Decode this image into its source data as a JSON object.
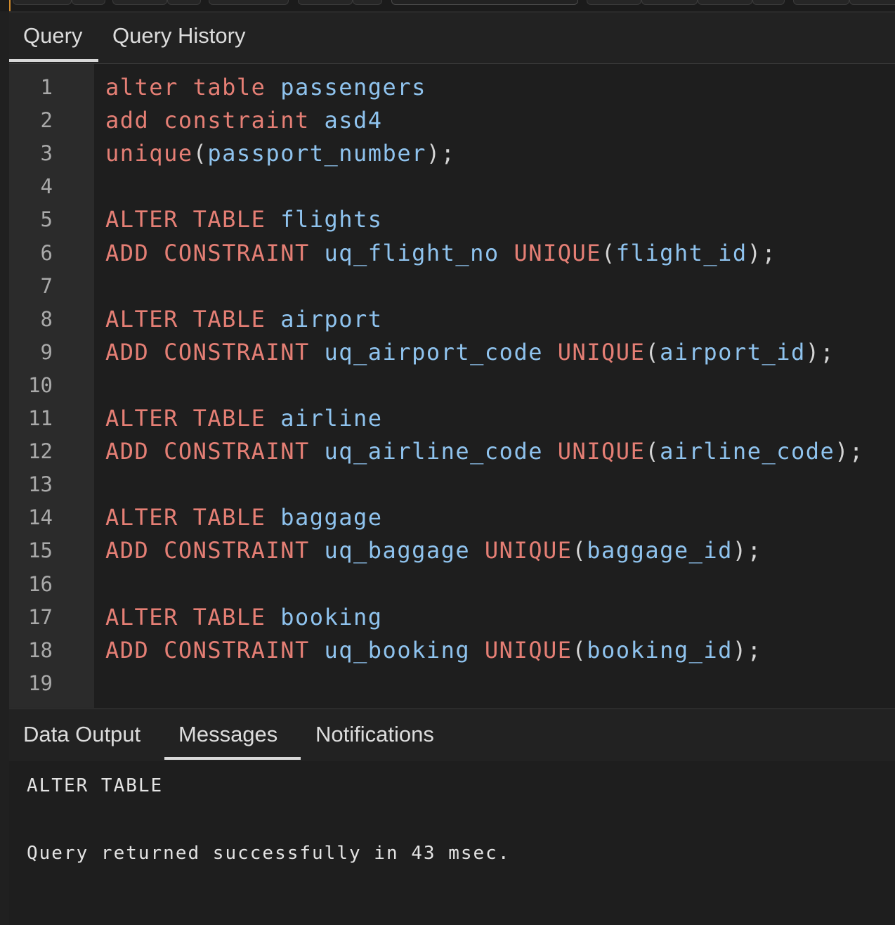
{
  "query_tabs": [
    {
      "label": "Query",
      "active": true
    },
    {
      "label": "Query History",
      "active": false
    }
  ],
  "editor": {
    "line_numbers": [
      "1",
      "2",
      "3",
      "4",
      "5",
      "6",
      "7",
      "8",
      "9",
      "10",
      "11",
      "12",
      "13",
      "14",
      "15",
      "16",
      "17",
      "18",
      "19"
    ],
    "lines": [
      [
        {
          "t": "alter",
          "c": "kw"
        },
        {
          "t": " ",
          "c": "pu"
        },
        {
          "t": "table",
          "c": "kw"
        },
        {
          "t": " ",
          "c": "pu"
        },
        {
          "t": "passengers",
          "c": "id"
        }
      ],
      [
        {
          "t": "add",
          "c": "kw"
        },
        {
          "t": " ",
          "c": "pu"
        },
        {
          "t": "constraint",
          "c": "kw"
        },
        {
          "t": " ",
          "c": "pu"
        },
        {
          "t": "asd4",
          "c": "id"
        }
      ],
      [
        {
          "t": "unique",
          "c": "kw"
        },
        {
          "t": "(",
          "c": "pu"
        },
        {
          "t": "passport_number",
          "c": "id"
        },
        {
          "t": ");",
          "c": "pu"
        }
      ],
      [],
      [
        {
          "t": "ALTER",
          "c": "kw"
        },
        {
          "t": " ",
          "c": "pu"
        },
        {
          "t": "TABLE",
          "c": "kw"
        },
        {
          "t": " ",
          "c": "pu"
        },
        {
          "t": "flights",
          "c": "id"
        }
      ],
      [
        {
          "t": "ADD",
          "c": "kw"
        },
        {
          "t": " ",
          "c": "pu"
        },
        {
          "t": "CONSTRAINT",
          "c": "kw"
        },
        {
          "t": " ",
          "c": "pu"
        },
        {
          "t": "uq_flight_no",
          "c": "id"
        },
        {
          "t": " ",
          "c": "pu"
        },
        {
          "t": "UNIQUE",
          "c": "kw"
        },
        {
          "t": "(",
          "c": "pu"
        },
        {
          "t": "flight_id",
          "c": "id"
        },
        {
          "t": ");",
          "c": "pu"
        }
      ],
      [],
      [
        {
          "t": "ALTER",
          "c": "kw"
        },
        {
          "t": " ",
          "c": "pu"
        },
        {
          "t": "TABLE",
          "c": "kw"
        },
        {
          "t": " ",
          "c": "pu"
        },
        {
          "t": "airport",
          "c": "id"
        }
      ],
      [
        {
          "t": "ADD",
          "c": "kw"
        },
        {
          "t": " ",
          "c": "pu"
        },
        {
          "t": "CONSTRAINT",
          "c": "kw"
        },
        {
          "t": " ",
          "c": "pu"
        },
        {
          "t": "uq_airport_code",
          "c": "id"
        },
        {
          "t": " ",
          "c": "pu"
        },
        {
          "t": "UNIQUE",
          "c": "kw"
        },
        {
          "t": "(",
          "c": "pu"
        },
        {
          "t": "airport_id",
          "c": "id"
        },
        {
          "t": ");",
          "c": "pu"
        }
      ],
      [],
      [
        {
          "t": "ALTER",
          "c": "kw"
        },
        {
          "t": " ",
          "c": "pu"
        },
        {
          "t": "TABLE",
          "c": "kw"
        },
        {
          "t": " ",
          "c": "pu"
        },
        {
          "t": "airline",
          "c": "id"
        }
      ],
      [
        {
          "t": "ADD",
          "c": "kw"
        },
        {
          "t": " ",
          "c": "pu"
        },
        {
          "t": "CONSTRAINT",
          "c": "kw"
        },
        {
          "t": " ",
          "c": "pu"
        },
        {
          "t": "uq_airline_code",
          "c": "id"
        },
        {
          "t": " ",
          "c": "pu"
        },
        {
          "t": "UNIQUE",
          "c": "kw"
        },
        {
          "t": "(",
          "c": "pu"
        },
        {
          "t": "airline_code",
          "c": "id"
        },
        {
          "t": ");",
          "c": "pu"
        }
      ],
      [],
      [
        {
          "t": "ALTER",
          "c": "kw"
        },
        {
          "t": " ",
          "c": "pu"
        },
        {
          "t": "TABLE",
          "c": "kw"
        },
        {
          "t": " ",
          "c": "pu"
        },
        {
          "t": "baggage",
          "c": "id"
        }
      ],
      [
        {
          "t": "ADD",
          "c": "kw"
        },
        {
          "t": " ",
          "c": "pu"
        },
        {
          "t": "CONSTRAINT",
          "c": "kw"
        },
        {
          "t": " ",
          "c": "pu"
        },
        {
          "t": "uq_baggage",
          "c": "id"
        },
        {
          "t": " ",
          "c": "pu"
        },
        {
          "t": "UNIQUE",
          "c": "kw"
        },
        {
          "t": "(",
          "c": "pu"
        },
        {
          "t": "baggage_id",
          "c": "id"
        },
        {
          "t": ");",
          "c": "pu"
        }
      ],
      [],
      [
        {
          "t": "ALTER",
          "c": "kw"
        },
        {
          "t": " ",
          "c": "pu"
        },
        {
          "t": "TABLE",
          "c": "kw"
        },
        {
          "t": " ",
          "c": "pu"
        },
        {
          "t": "booking",
          "c": "id"
        }
      ],
      [
        {
          "t": "ADD",
          "c": "kw"
        },
        {
          "t": " ",
          "c": "pu"
        },
        {
          "t": "CONSTRAINT",
          "c": "kw"
        },
        {
          "t": " ",
          "c": "pu"
        },
        {
          "t": "uq_booking",
          "c": "id"
        },
        {
          "t": " ",
          "c": "pu"
        },
        {
          "t": "UNIQUE",
          "c": "kw"
        },
        {
          "t": "(",
          "c": "pu"
        },
        {
          "t": "booking_id",
          "c": "id"
        },
        {
          "t": ");",
          "c": "pu"
        }
      ],
      []
    ]
  },
  "output_tabs": [
    {
      "label": "Data Output",
      "active": false
    },
    {
      "label": "Messages",
      "active": true
    },
    {
      "label": "Notifications",
      "active": false
    }
  ],
  "messages": {
    "line1": "ALTER TABLE",
    "line2": "Query returned successfully in 43 msec."
  },
  "colors": {
    "keyword": "#e57f75",
    "identifier": "#8fc3ee",
    "accent_edge": "#d18b2c"
  }
}
